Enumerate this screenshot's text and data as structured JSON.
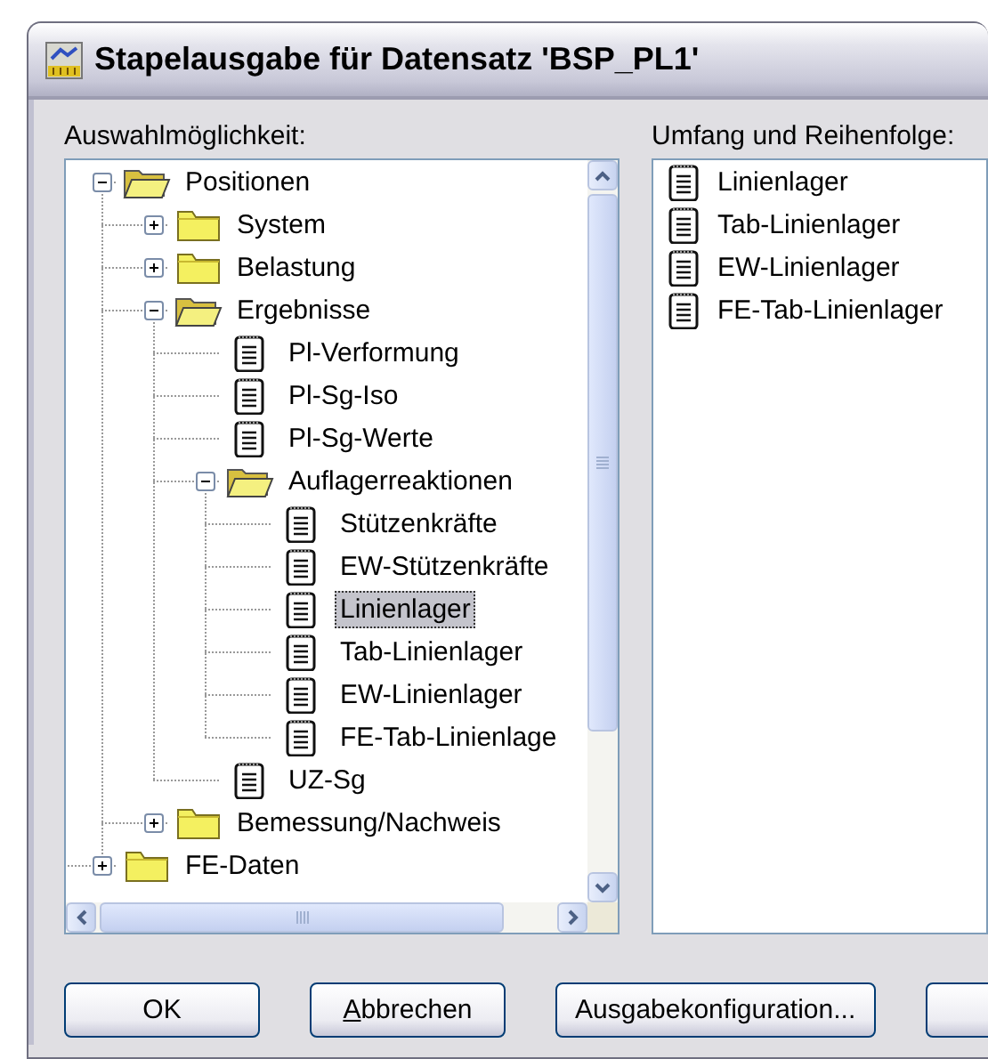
{
  "window": {
    "title": "Stapelausgabe für Datensatz 'BSP_PL1'"
  },
  "selection": {
    "label": "Auswahlmöglichkeit:",
    "tree": [
      {
        "label": "Positionen",
        "kind": "folder",
        "expanded": true,
        "selected": false,
        "children": [
          {
            "label": "System",
            "kind": "folder",
            "expanded": false,
            "selected": false
          },
          {
            "label": "Belastung",
            "kind": "folder",
            "expanded": false,
            "selected": false
          },
          {
            "label": "Ergebnisse",
            "kind": "folder",
            "expanded": true,
            "selected": false,
            "children": [
              {
                "label": "Pl-Verformung",
                "kind": "document",
                "selected": false
              },
              {
                "label": "Pl-Sg-Iso",
                "kind": "document",
                "selected": false
              },
              {
                "label": "Pl-Sg-Werte",
                "kind": "document",
                "selected": false
              },
              {
                "label": "Auflagerreaktionen",
                "kind": "folder",
                "expanded": true,
                "selected": false,
                "children": [
                  {
                    "label": "Stützenkräfte",
                    "kind": "document",
                    "selected": false
                  },
                  {
                    "label": "EW-Stützenkräfte",
                    "kind": "document",
                    "selected": false
                  },
                  {
                    "label": "Linienlager",
                    "kind": "document",
                    "selected": true
                  },
                  {
                    "label": "Tab-Linienlager",
                    "kind": "document",
                    "selected": false
                  },
                  {
                    "label": "EW-Linienlager",
                    "kind": "document",
                    "selected": false
                  },
                  {
                    "label": "FE-Tab-Linienlage",
                    "kind": "document",
                    "selected": false
                  }
                ]
              },
              {
                "label": "UZ-Sg",
                "kind": "document",
                "selected": false
              }
            ]
          },
          {
            "label": "Bemessung/Nachweis",
            "kind": "folder",
            "expanded": false,
            "selected": false
          }
        ]
      },
      {
        "label": "FE-Daten",
        "kind": "folder",
        "expanded": false,
        "selected": false
      }
    ]
  },
  "order": {
    "label": "Umfang und Reihenfolge:",
    "items": [
      {
        "label": "Linienlager"
      },
      {
        "label": "Tab-Linienlager"
      },
      {
        "label": "EW-Linienlager"
      },
      {
        "label": "FE-Tab-Linienlager"
      }
    ]
  },
  "buttons": [
    {
      "kind": "full",
      "label": "OK",
      "mnemonic_first": false
    },
    {
      "kind": "full",
      "label": "Abbrechen",
      "mnemonic_first": true
    },
    {
      "kind": "full",
      "label": "Ausgabekonfiguration...",
      "mnemonic_first": false
    },
    {
      "kind": "cut"
    }
  ]
}
